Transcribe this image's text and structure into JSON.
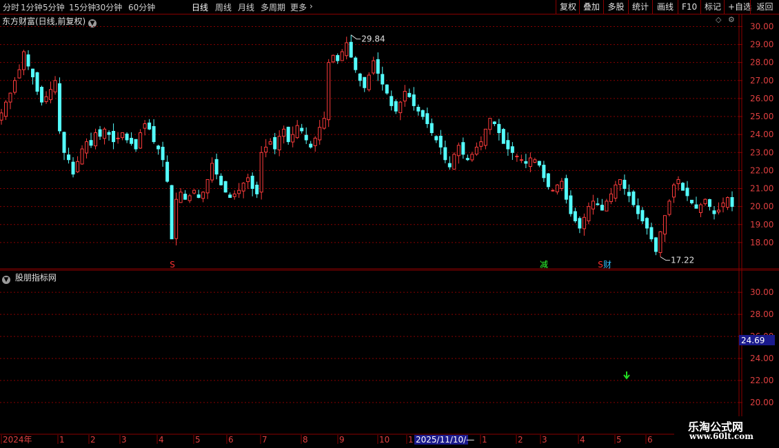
{
  "toolbar": {
    "periods": [
      {
        "label": "分时"
      },
      {
        "label": "1分钟"
      },
      {
        "label": "5分钟"
      },
      {
        "label": "15分钟"
      },
      {
        "label": "30分钟"
      },
      {
        "label": "60分钟"
      },
      {
        "label": "日线",
        "active": true
      },
      {
        "label": "周线"
      },
      {
        "label": "月线"
      },
      {
        "label": "多周期"
      },
      {
        "label": "更多"
      }
    ],
    "more_arrow": "›",
    "buttons": [
      {
        "label": "复权"
      },
      {
        "label": "叠加"
      },
      {
        "label": "多股"
      },
      {
        "label": "统计"
      },
      {
        "label": "画线"
      },
      {
        "label": "F10"
      },
      {
        "label": "标记"
      },
      {
        "label": "+自选"
      },
      {
        "label": "返回"
      }
    ]
  },
  "main_panel": {
    "title": "东方财富(日线,前复权)",
    "high_label": "29.84",
    "low_label": "17.22",
    "markers": [
      {
        "text": "S",
        "color": "#ff3030"
      },
      {
        "text": "减",
        "color": "#30ff30"
      },
      {
        "text": "S",
        "color": "#ff3030"
      },
      {
        "text": "财",
        "color": "#30c0ff"
      }
    ]
  },
  "indicator_panel": {
    "title": "股朋指标网",
    "current_value": "24.69"
  },
  "axis_bottom": {
    "labels": [
      "2024年",
      "1",
      "2",
      "3",
      "4",
      "5",
      "6",
      "7",
      "8",
      "9",
      "10",
      "11"
    ],
    "highlight": "2025/11/10/—",
    "labels_after": [
      "1",
      "2",
      "3",
      "4",
      "5",
      "6"
    ]
  },
  "watermark": {
    "line1": "乐淘公式网",
    "line2": "www.60lt.com"
  },
  "colors": {
    "up": "#ff3c3c",
    "down": "#54fcfc",
    "grid": "#8b0000",
    "highlight_bg": "#1a1a8c"
  },
  "chart_data": {
    "type": "candlestick",
    "price_axis": {
      "ticks": [
        "30.00",
        "29.00",
        "28.00",
        "27.00",
        "26.00",
        "25.00",
        "24.00",
        "23.00",
        "22.00",
        "21.00",
        "20.00",
        "19.00",
        "18.00"
      ],
      "range": [
        17.0,
        30.4
      ]
    },
    "indicator_axis": {
      "ticks": [
        "30.00",
        "28.00",
        "26.00",
        "24.00",
        "22.00",
        "20.00"
      ],
      "range": [
        19.0,
        31.2
      ],
      "signal_arrow": {
        "direction": "down",
        "value": 22.0
      }
    },
    "closes": [
      25.2,
      25.8,
      26.3,
      27.0,
      27.6,
      28.6,
      27.8,
      27.2,
      26.4,
      25.8,
      26.1,
      26.5,
      27.0,
      24.2,
      23.0,
      22.6,
      21.8,
      22.5,
      23.2,
      23.6,
      23.4,
      24.1,
      23.9,
      24.3,
      24.0,
      23.6,
      23.8,
      24.1,
      23.7,
      23.5,
      23.2,
      24.1,
      24.6,
      24.3,
      23.6,
      23.2,
      22.6,
      21.4,
      18.2,
      20.4,
      20.8,
      20.4,
      20.6,
      20.9,
      20.5,
      20.8,
      21.5,
      22.4,
      21.8,
      21.2,
      20.8,
      20.5,
      20.7,
      20.9,
      21.3,
      21.6,
      21.0,
      20.7,
      23.0,
      23.3,
      23.6,
      23.2,
      23.9,
      24.3,
      23.6,
      24.0,
      24.5,
      24.2,
      23.7,
      23.3,
      23.8,
      24.4,
      24.9,
      28.0,
      28.4,
      28.1,
      28.6,
      29.1,
      28.3,
      27.6,
      27.0,
      26.6,
      27.3,
      28.1,
      27.4,
      26.8,
      26.3,
      25.6,
      25.3,
      25.8,
      26.4,
      26.1,
      25.6,
      25.3,
      25.0,
      24.6,
      24.1,
      23.7,
      23.3,
      22.6,
      22.2,
      22.9,
      23.4,
      22.9,
      22.6,
      22.9,
      23.3,
      23.6,
      24.3,
      24.9,
      24.6,
      24.1,
      23.5,
      23.2,
      23.0,
      22.8,
      22.6,
      22.4,
      22.7,
      22.6,
      22.3,
      21.6,
      21.1,
      20.9,
      21.2,
      21.4,
      20.4,
      19.6,
      19.2,
      18.8,
      19.4,
      20.0,
      20.3,
      20.1,
      19.8,
      20.3,
      20.7,
      21.2,
      21.5,
      21.0,
      20.6,
      20.1,
      19.6,
      19.2,
      18.8,
      18.2,
      17.5,
      18.6,
      19.5,
      20.3,
      21.2,
      21.5,
      20.9,
      20.6,
      20.2,
      19.9,
      20.1,
      20.4,
      20.0,
      19.6,
      19.8,
      20.2,
      20.5,
      20.0
    ]
  }
}
